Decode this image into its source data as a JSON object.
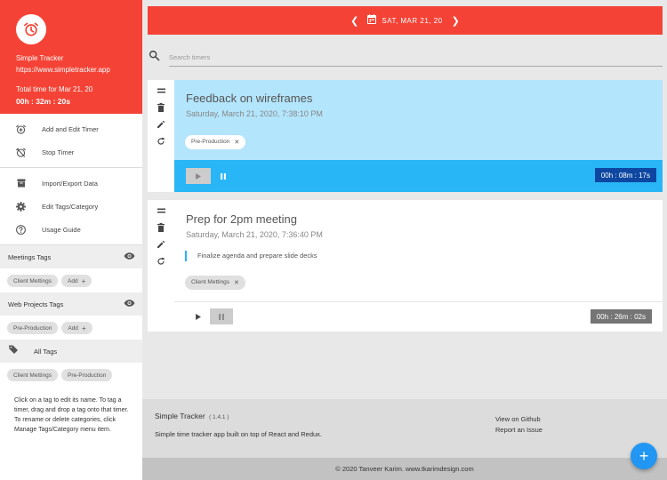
{
  "colors": {
    "accent": "#f44336",
    "blue": "#29b6f6",
    "light_blue": "#b3e5fc",
    "fab": "#2196f3"
  },
  "sidebar": {
    "app_name": "Simple Tracker",
    "app_url": "https://www.simpletracker.app",
    "total_label": "Total time for Mar 21, 20",
    "total_value": "00h : 32m : 20s",
    "menu": [
      {
        "label": "Add and Edit Timer",
        "icon": "alarm-add-icon"
      },
      {
        "label": "Stop Timer",
        "icon": "alarm-off-icon"
      }
    ],
    "menu2": [
      {
        "label": "Import/Export Data",
        "icon": "archive-icon"
      },
      {
        "label": "Edit Tags/Category",
        "icon": "gear-icon"
      },
      {
        "label": "Usage Guide",
        "icon": "help-icon"
      }
    ],
    "categories": [
      {
        "title": "Meetings Tags",
        "tags": [
          "Client Mettings"
        ],
        "add_label": "Add"
      },
      {
        "title": "Web Projects Tags",
        "tags": [
          "Pre-Production"
        ],
        "add_label": "Add"
      }
    ],
    "all_tags_title": "All Tags",
    "all_tags": [
      "Client Mettings",
      "Pre-Production"
    ],
    "help_text": "Click on a tag to edit its name. To tag a timer, drag and drop a tag onto that timer. To rename or delete categories, click Manage Tags/Category menu item."
  },
  "topbar": {
    "date": "SAT, MAR 21, 20"
  },
  "search": {
    "placeholder": "Search timers"
  },
  "timers": [
    {
      "title": "Feedback on wireframes",
      "subtitle": "Saturday, March 21, 2020, 7:38:10 PM",
      "tag": "Pre-Production",
      "elapsed": "00h : 08m : 17s",
      "running": true
    },
    {
      "title": "Prep for 2pm meeting",
      "subtitle": "Saturday, March 21, 2020, 7:36:40 PM",
      "description": "Finalize agenda and prepare slide decks",
      "tag": "Client Mettings",
      "elapsed": "00h : 26m : 02s",
      "running": false
    }
  ],
  "footer": {
    "name": "Simple Tracker",
    "version": "( 1.4.1 )",
    "description": "Simple time tracker app built on top of React and Redux.",
    "github_label": "View on Github",
    "issue_label": "Report an Issue",
    "copyright": "© 2020 Tanveer Karim. www.tkarimdesign.com"
  },
  "fab_label": "+"
}
